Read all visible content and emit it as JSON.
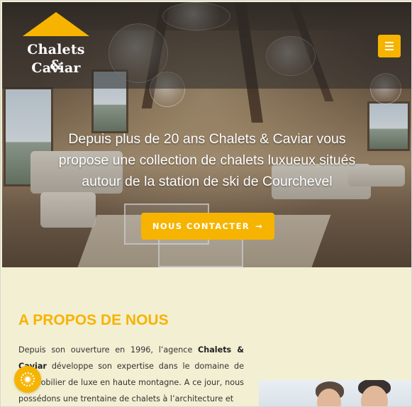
{
  "brand": {
    "name_line1": "Chalets &",
    "name_line2": "Caviar",
    "accent_color": "#f6b400"
  },
  "header": {
    "menu_icon": "hamburger-icon"
  },
  "hero": {
    "tagline": "Depuis plus de 20 ans Chalets & Caviar vous propose une collection de chalets luxueux situés autour de la station de ski de Courchevel",
    "cta_label": "NOUS CONTACTER",
    "cta_icon": "arrow-right-icon",
    "cta_arrow": "→"
  },
  "about": {
    "title": "A PROPOS DE NOUS",
    "text_part1": "Depuis son ouverture en 1996, l’agence ",
    "text_bold": "Chalets & Caviar",
    "text_part2": " développe son expertise dans le domaine de l’immobilier de luxe en haute montagne. A ce jour, nous possédons une trentaine de chalets à l’architecture et"
  },
  "chat": {
    "icon": "chat-icon"
  }
}
